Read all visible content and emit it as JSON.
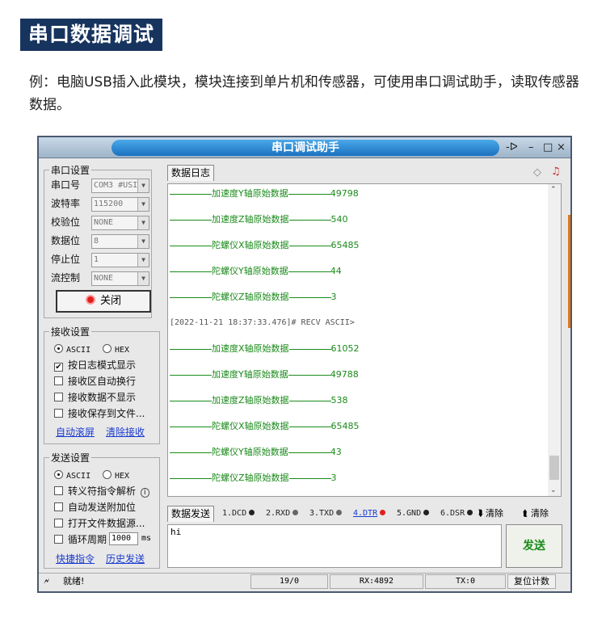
{
  "heading": "串口数据调试",
  "description": "例：电脑USB插入此模块，模块连接到单片机和传感器，可使用串口调试助手，读取传感器数据。",
  "window": {
    "title": "串口调试助手",
    "controls": {
      "pin": "-ᐅ",
      "minimize": "–",
      "restore": "□",
      "close": "×"
    }
  },
  "port_settings": {
    "title": "串口设置",
    "rows": [
      {
        "label": "串口号",
        "value": "COM3 #USI"
      },
      {
        "label": "波特率",
        "value": "115200"
      },
      {
        "label": "校验位",
        "value": "NONE"
      },
      {
        "label": "数据位",
        "value": "8"
      },
      {
        "label": "停止位",
        "value": "1"
      },
      {
        "label": "流控制",
        "value": "NONE"
      }
    ],
    "close_button": "关闭"
  },
  "receive_settings": {
    "title": "接收设置",
    "mode_ascii": "ASCII",
    "mode_hex": "HEX",
    "options": [
      {
        "label": "按日志模式显示",
        "checked": true
      },
      {
        "label": "接收区自动换行",
        "checked": false
      },
      {
        "label": "接收数据不显示",
        "checked": false
      },
      {
        "label": "接收保存到文件...",
        "checked": false
      }
    ],
    "link_autoscroll": "自动滚屏",
    "link_clear": "清除接收"
  },
  "send_settings": {
    "title": "发送设置",
    "mode_ascii": "ASCII",
    "mode_hex": "HEX",
    "options": [
      {
        "label": "转义符指令解析",
        "checked": false
      },
      {
        "label": "自动发送附加位",
        "checked": false
      },
      {
        "label": "打开文件数据源...",
        "checked": false
      },
      {
        "label": "循环周期",
        "checked": false
      }
    ],
    "period_value": "1000",
    "period_unit": "ms",
    "link_shortcut": "快捷指令",
    "link_history": "历史发送"
  },
  "log": {
    "tab": "数据日志",
    "lines": [
      {
        "label": "加速度Y轴原始数据",
        "value": "49798"
      },
      {
        "label": "加速度Z轴原始数据",
        "value": "540"
      },
      {
        "label": "陀螺仪X轴原始数据",
        "value": "65485"
      },
      {
        "label": "陀螺仪Y轴原始数据",
        "value": "44"
      },
      {
        "label": "陀螺仪Z轴原始数据",
        "value": "3"
      },
      {
        "meta": "[2022-11-21 18:37:33.476]# RECV ASCII>"
      },
      {
        "label": "加速度X轴原始数据",
        "value": "61052"
      },
      {
        "label": "加速度Y轴原始数据",
        "value": "49788"
      },
      {
        "label": "加速度Z轴原始数据",
        "value": "538"
      },
      {
        "label": "陀螺仪X轴原始数据",
        "value": "65485"
      },
      {
        "label": "陀螺仪Y轴原始数据",
        "value": "43"
      },
      {
        "label": "陀螺仪Z轴原始数据",
        "value": "3"
      }
    ]
  },
  "send_area": {
    "tab": "数据发送",
    "signals": [
      {
        "label": "1.DCD",
        "color": "#222222"
      },
      {
        "label": "2.RXD",
        "color": "#666666"
      },
      {
        "label": "3.TXD",
        "color": "#666666"
      },
      {
        "label": "4.DTR",
        "color": "#e02020"
      },
      {
        "label": "5.GND",
        "color": "#222222"
      },
      {
        "label": "6.DSR",
        "color": "#222222"
      }
    ],
    "clear_recv": "清除",
    "clear_send": "清除",
    "input_value": "hi",
    "send_button": "发送"
  },
  "status": {
    "text": "就绪!",
    "count": "19/0",
    "rx": "RX:4892",
    "tx": "TX:0",
    "reset": "复位计数"
  },
  "colors": {
    "heading_bg": "#17345e",
    "log_green": "#1a8a1a",
    "title_blue": "#1b72c0"
  }
}
